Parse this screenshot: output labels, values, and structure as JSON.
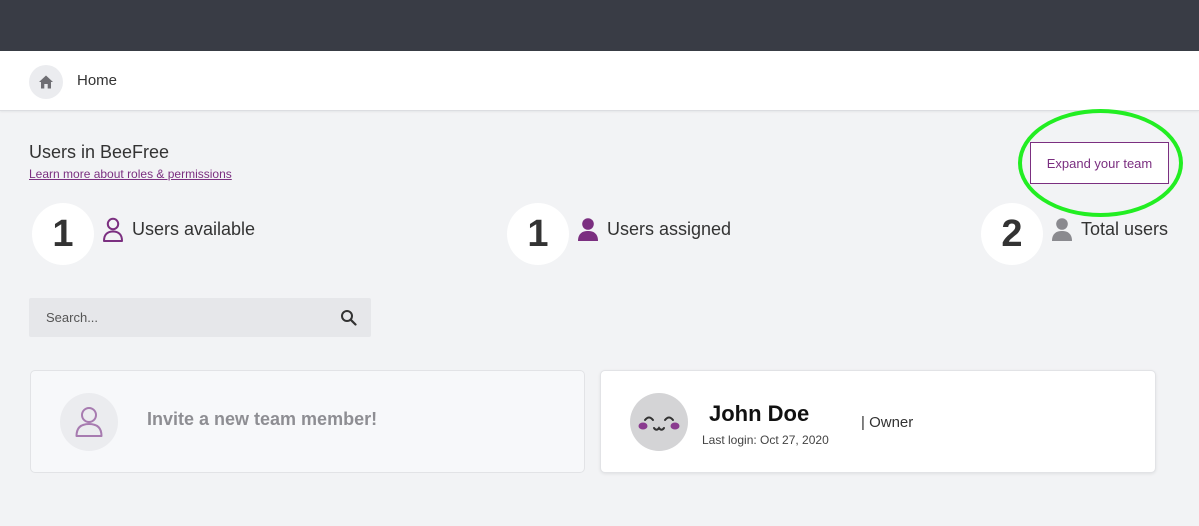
{
  "breadcrumb": {
    "home_label": "Home"
  },
  "header": {
    "title": "Users in BeeFree",
    "learn_link": "Learn more about roles & permissions",
    "expand_button": "Expand your team"
  },
  "stats": [
    {
      "value": "1",
      "label": "Users available",
      "icon": "user-outline-icon"
    },
    {
      "value": "1",
      "label": "Users assigned",
      "icon": "user-filled-icon"
    },
    {
      "value": "2",
      "label": "Total users",
      "icon": "user-gray-icon"
    }
  ],
  "search": {
    "placeholder": "Search..."
  },
  "invite_card": {
    "label": "Invite a new team member!"
  },
  "user_card": {
    "name": "John Doe",
    "role": "| Owner",
    "last_login": "Last login: Oct 27, 2020"
  },
  "colors": {
    "topbar": "#393c45",
    "accent": "#7b2f80",
    "highlight": "#22ee22",
    "background": "#f2f3f5"
  }
}
